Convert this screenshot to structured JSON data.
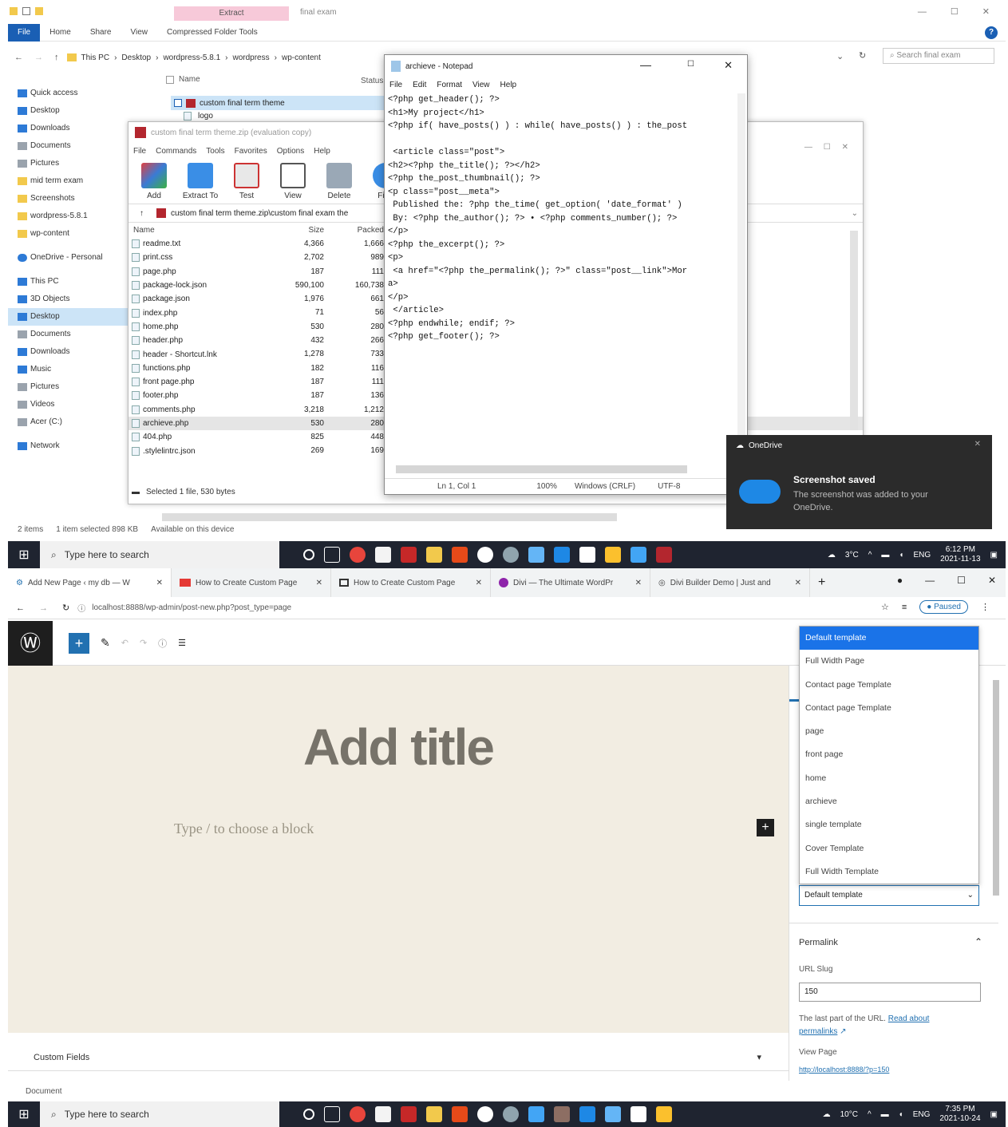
{
  "explorer": {
    "context_tab": "Extract",
    "folder_name": "final exam",
    "ribbon_tabs": [
      "File",
      "Home",
      "Share",
      "View",
      "Compressed Folder Tools"
    ],
    "breadcrumb": [
      "This PC",
      "Desktop",
      "wordpress-5.8.1",
      "wordpress",
      "wp-content"
    ],
    "search_placeholder": "Search final exam",
    "nav": [
      "Quick access",
      "Desktop",
      "Downloads",
      "Documents",
      "Pictures",
      "mid term exam",
      "Screenshots",
      "wordpress-5.8.1",
      "wp-content",
      "OneDrive - Personal",
      "This PC",
      "3D Objects",
      "Desktop",
      "Documents",
      "Downloads",
      "Music",
      "Pictures",
      "Videos",
      "Acer (C:)",
      "Network"
    ],
    "col_name": "Name",
    "col_status": "Status",
    "items": [
      "custom final term theme",
      "logo"
    ],
    "status": {
      "count": "2 items",
      "selected": "1 item selected  898 KB",
      "availability": "Available on this device"
    }
  },
  "zip": {
    "title": "custom final term theme.zip (evaluation copy)",
    "menu": [
      "File",
      "Commands",
      "Tools",
      "Favorites",
      "Options",
      "Help"
    ],
    "tools": [
      "Add",
      "Extract To",
      "Test",
      "View",
      "Delete",
      "Find"
    ],
    "path": "custom final term theme.zip\\custom final exam the",
    "cols": [
      "Name",
      "Size",
      "Packed"
    ],
    "files": [
      {
        "name": "readme.txt",
        "size": "4,366",
        "packed": "1,666"
      },
      {
        "name": "print.css",
        "size": "2,702",
        "packed": "989"
      },
      {
        "name": "page.php",
        "size": "187",
        "packed": "111"
      },
      {
        "name": "package-lock.json",
        "size": "590,100",
        "packed": "160,738"
      },
      {
        "name": "package.json",
        "size": "1,976",
        "packed": "661"
      },
      {
        "name": "index.php",
        "size": "71",
        "packed": "56"
      },
      {
        "name": "home.php",
        "size": "530",
        "packed": "280"
      },
      {
        "name": "header.php",
        "size": "432",
        "packed": "266"
      },
      {
        "name": "header - Shortcut.lnk",
        "size": "1,278",
        "packed": "733"
      },
      {
        "name": "functions.php",
        "size": "182",
        "packed": "116"
      },
      {
        "name": "front page.php",
        "size": "187",
        "packed": "111"
      },
      {
        "name": "footer.php",
        "size": "187",
        "packed": "136"
      },
      {
        "name": "comments.php",
        "size": "3,218",
        "packed": "1,212"
      },
      {
        "name": "archieve.php",
        "size": "530",
        "packed": "280"
      },
      {
        "name": "404.php",
        "size": "825",
        "packed": "448"
      },
      {
        "name": ".stylelintrc.json",
        "size": "269",
        "packed": "169"
      }
    ],
    "status": "Selected 1 file, 530 bytes"
  },
  "notepad": {
    "title": "archieve - Notepad",
    "menu": [
      "File",
      "Edit",
      "Format",
      "View",
      "Help"
    ],
    "code": "<?php get_header(); ?>\n<h1>My project</h1>\n<?php if( have_posts() ) : while( have_posts() ) : the_post\n\n <article class=\"post\">\n<h2><?php the_title(); ?></h2>\n<?php the_post_thumbnail(); ?>\n<p class=\"post__meta\">\n Published the: ?php the_time( get_option( 'date_format' )\n By: <?php the_author(); ?> • <?php comments_number(); ?>\n</p>\n<?php the_excerpt(); ?>\n<p>\n <a href=\"<?php the_permalink(); ?>\" class=\"post__link\">Mor\na>\n</p>\n </article>\n<?php endwhile; endif; ?>\n<?php get_footer(); ?>",
    "status": {
      "pos": "Ln 1, Col 1",
      "zoom": "100%",
      "eol": "Windows (CRLF)",
      "enc": "UTF-8"
    }
  },
  "toast": {
    "app": "OneDrive",
    "title": "Screenshot saved",
    "body": "The screenshot was added to your OneDrive."
  },
  "taskbar1": {
    "search": "Type here to search",
    "temp": "3°C",
    "lang": "ENG",
    "time": "6:12 PM",
    "date": "2021-11-13"
  },
  "browser": {
    "tabs": [
      "Add New Page ‹ my db — W",
      "How to Create Custom Page",
      "How to Create Custom Page",
      "Divi — The Ultimate WordPr",
      "Divi Builder Demo | Just and"
    ],
    "url": "localhost:8888/wp-admin/post-new.php?post_type=page",
    "profile": "Paused",
    "editor": {
      "title_placeholder": "Add title",
      "block_placeholder": "Type / to choose a block",
      "custom_fields": "Custom Fields",
      "footer": "Document"
    },
    "template_options": [
      "Default template",
      "Full Width Page",
      "Contact page Template",
      "Contact page Template",
      "page",
      "front page",
      "home",
      "archieve",
      "single template",
      "Cover Template",
      "Full Width Template"
    ],
    "template_selected": "Default template",
    "permalink": {
      "heading": "Permalink",
      "slug_label": "URL Slug",
      "slug": "150",
      "help": "The last part of the URL.",
      "help_link": "Read about permalinks",
      "view_page": "View Page",
      "link": "http://localhost:8888/?p=150"
    }
  },
  "taskbar2": {
    "search": "Type here to search",
    "temp": "10°C",
    "lang": "ENG",
    "time": "7:35 PM",
    "date": "2021-10-24"
  }
}
